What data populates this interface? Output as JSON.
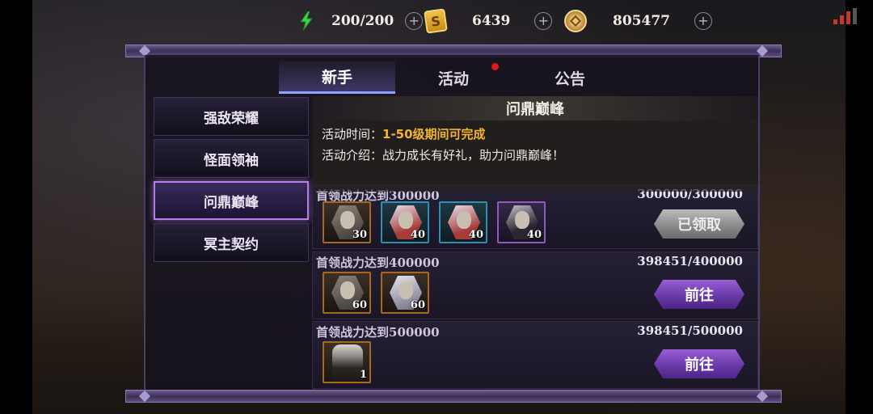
{
  "resources": {
    "energy": {
      "icon": "lightning-icon",
      "value": "200/200"
    },
    "ticket": {
      "icon": "ticket-icon",
      "glyph": "S",
      "value": "6439"
    },
    "coin": {
      "icon": "coin-icon",
      "value": "805477"
    },
    "plus_glyph": "+"
  },
  "tabs": [
    {
      "label": "新手",
      "active": true
    },
    {
      "label": "活动",
      "active": false,
      "has_dot": true
    },
    {
      "label": "公告",
      "active": false
    }
  ],
  "menu": [
    {
      "label": "强敌荣耀",
      "active": false
    },
    {
      "label": "怪面领袖",
      "active": false
    },
    {
      "label": "问鼎巅峰",
      "active": true
    },
    {
      "label": "冥主契约",
      "active": false
    }
  ],
  "event": {
    "title": "问鼎巅峰",
    "time_label": "活动时间：",
    "time_value": "1-50级期间可完成",
    "intro_label": "活动介绍：",
    "intro_value": "战力成长有好礼，助力问鼎巅峰！"
  },
  "rewards": [
    {
      "title": "首领战力达到300000",
      "progress": "300000/300000",
      "button": "已领取",
      "items": [
        {
          "count": "30",
          "frame": "orange"
        },
        {
          "count": "40",
          "frame": "blue"
        },
        {
          "count": "40",
          "frame": "blue"
        },
        {
          "count": "40",
          "frame": "purple"
        }
      ]
    },
    {
      "title": "首领战力达到400000",
      "progress": "398451/400000",
      "button": "前往",
      "items": [
        {
          "count": "60",
          "frame": "orange"
        },
        {
          "count": "60",
          "frame": "orange"
        }
      ]
    },
    {
      "title": "首领战力达到500000",
      "progress": "398451/500000",
      "button": "前往",
      "items": [
        {
          "count": "1",
          "frame": "orange"
        }
      ]
    }
  ],
  "colors": {
    "accent_purple": "#b27ee8",
    "highlight_gold": "#f3b52f",
    "notification_red": "#e01818"
  }
}
